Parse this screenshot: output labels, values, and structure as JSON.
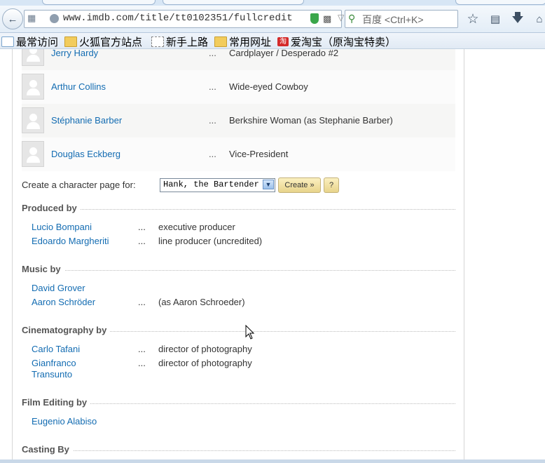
{
  "browser": {
    "url": "www.imdb.com/title/tt0102351/fullcredit",
    "search_placeholder": "百度 <Ctrl+K>",
    "icons": {
      "back": "back-arrow-icon",
      "grid": "tab-groups-icon",
      "site": "globe-icon",
      "secure": "shield-icon",
      "qr": "qr-code-icon",
      "reload": "reload-icon",
      "search": "search-icon",
      "star": "star-icon",
      "reader": "reader-icon",
      "download": "download-arrow-icon",
      "home": "home-icon"
    }
  },
  "bookmarks": [
    {
      "label": "最常访问",
      "icon": "star-folder-icon"
    },
    {
      "label": "火狐官方站点",
      "icon": "folder-icon"
    },
    {
      "label": "新手上路",
      "icon": "page-icon"
    },
    {
      "label": "常用网址",
      "icon": "folder-icon"
    },
    {
      "label": "爱淘宝（原淘宝特卖）",
      "icon": "taobao-icon",
      "icon_text": "淘"
    }
  ],
  "cast_rows": [
    {
      "name": "Jerry Hardy",
      "dots": "...",
      "role": "Cardplayer / Desperado #2"
    },
    {
      "name": "Arthur Collins",
      "dots": "...",
      "role": "Wide-eyed Cowboy"
    },
    {
      "name": "Stéphanie Barber",
      "dots": "...",
      "role": "Berkshire Woman (as Stephanie Barber)"
    },
    {
      "name": "Douglas Eckberg",
      "dots": "...",
      "role": "Vice-President"
    }
  ],
  "character_page": {
    "label": "Create a character page for:",
    "selected": "Hank, the Bartender",
    "create_button": "Create »",
    "help_button": "?"
  },
  "sections": {
    "produced_by": {
      "title": "Produced by",
      "rows": [
        {
          "name": "Lucio Bompani",
          "dots": "...",
          "credit": "executive producer"
        },
        {
          "name": "Edoardo Margheriti",
          "dots": "...",
          "credit": "line producer (uncredited)"
        }
      ]
    },
    "music_by": {
      "title": "Music by",
      "rows": [
        {
          "name": "David Grover",
          "dots": "",
          "credit": ""
        },
        {
          "name": "Aaron Schröder",
          "dots": "...",
          "credit": "(as Aaron Schroeder)"
        }
      ]
    },
    "cinematography_by": {
      "title": "Cinematography by",
      "rows": [
        {
          "name": "Carlo Tafani",
          "dots": "...",
          "credit": "director of photography"
        },
        {
          "name": "Gianfranco Transunto",
          "dots": "...",
          "credit": "director of photography"
        }
      ]
    },
    "film_editing_by": {
      "title": "Film Editing by",
      "rows": [
        {
          "name": "Eugenio Alabiso",
          "dots": "",
          "credit": ""
        }
      ]
    },
    "casting_by": {
      "title": "Casting By"
    }
  },
  "colors": {
    "link": "#136cb2",
    "section_heading": "#555555",
    "button_gold": "#e8d48b"
  }
}
